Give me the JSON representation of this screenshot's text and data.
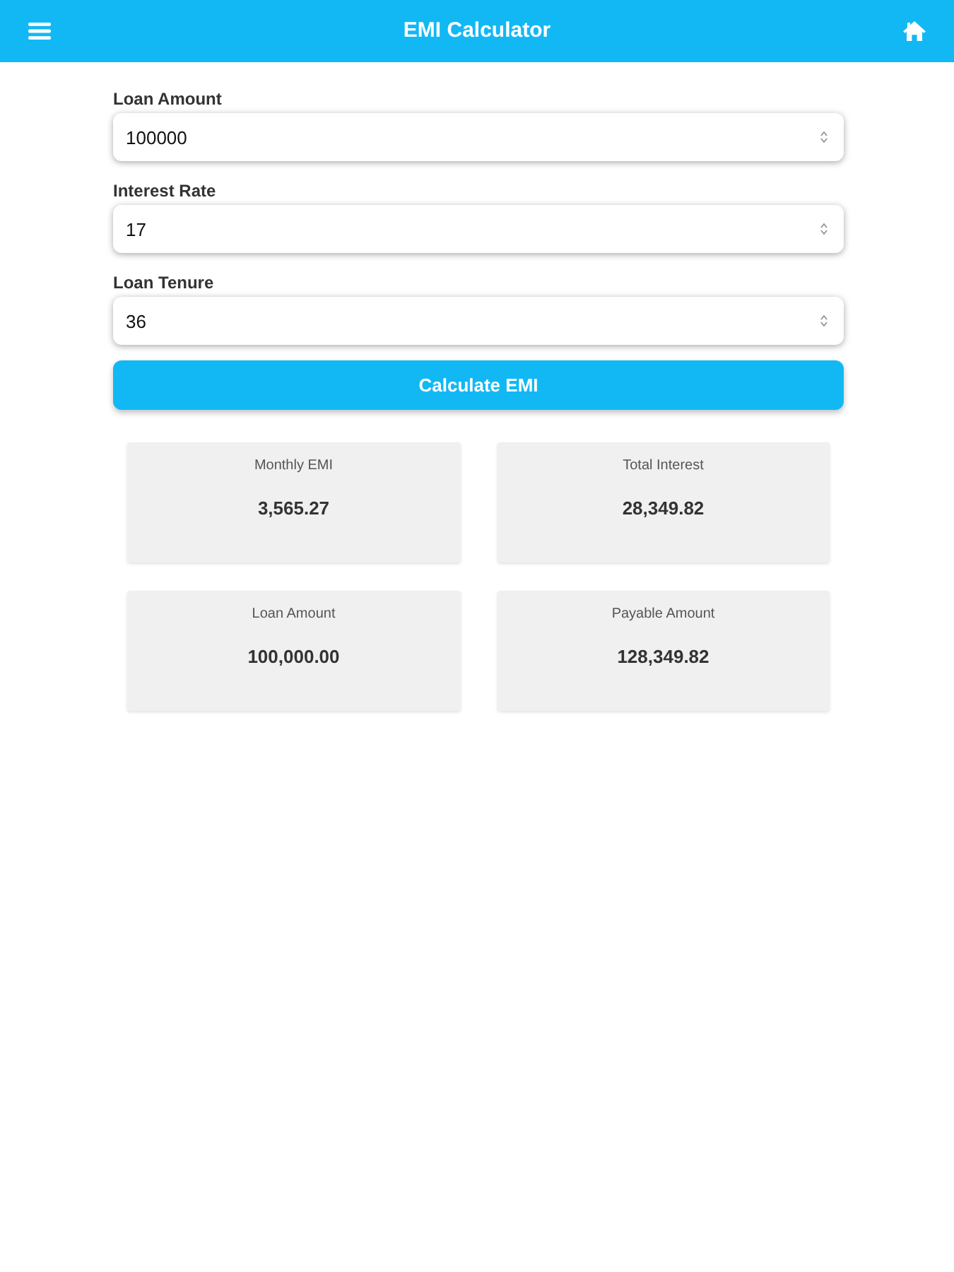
{
  "header": {
    "title": "EMI Calculator"
  },
  "form": {
    "fields": [
      {
        "label": "Loan Amount",
        "value": "100000"
      },
      {
        "label": "Interest Rate",
        "value": "17"
      },
      {
        "label": "Loan Tenure",
        "value": "36"
      }
    ],
    "button": "Calculate EMI"
  },
  "results": [
    {
      "label": "Monthly EMI",
      "value": "3,565.27"
    },
    {
      "label": "Total Interest",
      "value": "28,349.82"
    },
    {
      "label": "Loan Amount",
      "value": "100,000.00"
    },
    {
      "label": "Payable Amount",
      "value": "128,349.82"
    }
  ]
}
